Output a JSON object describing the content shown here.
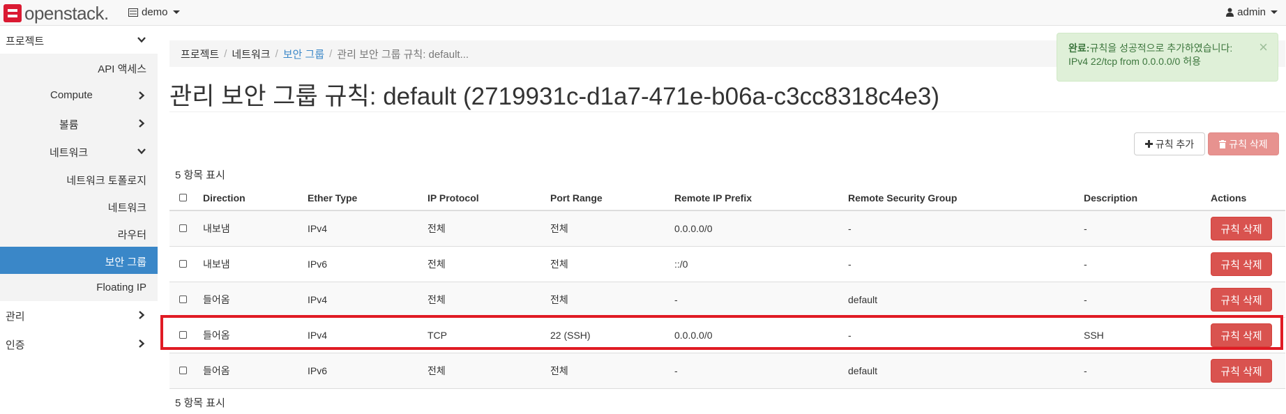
{
  "navbar": {
    "logo_text": "openstack.",
    "project_label": "demo",
    "user_label": "admin"
  },
  "sidebar": {
    "items": [
      {
        "label": "프로젝트",
        "chevron": "down"
      },
      {
        "label": "API 액세스"
      },
      {
        "label": "Compute",
        "chevron": "right"
      },
      {
        "label": "볼륨",
        "chevron": "right"
      },
      {
        "label": "네트워크",
        "chevron": "down"
      },
      {
        "label": "네트워크 토폴로지"
      },
      {
        "label": "네트워크"
      },
      {
        "label": "라우터"
      },
      {
        "label": "보안 그룹"
      },
      {
        "label": "Floating IP"
      },
      {
        "label": "관리",
        "chevron": "right"
      },
      {
        "label": "인증",
        "chevron": "right"
      }
    ]
  },
  "breadcrumb": {
    "items": [
      "프로젝트",
      "네트워크",
      "보안 그룹",
      "관리 보안 그룹 규칙: default..."
    ]
  },
  "page": {
    "title": "관리 보안 그룹 규칙: default (2719931c-d1a7-471e-b06a-c3cc8318c4e3)"
  },
  "alert": {
    "strong": "완료:",
    "message": "규칙을 성공적으로 추가하였습니다: IPv4 22/tcp from 0.0.0.0/0 허용",
    "close": "×"
  },
  "toolbar": {
    "add_label": "규칙 추가",
    "delete_label": "규칙 삭제"
  },
  "table": {
    "count_label": "5 항목 표시",
    "columns": [
      "Direction",
      "Ether Type",
      "IP Protocol",
      "Port Range",
      "Remote IP Prefix",
      "Remote Security Group",
      "Description",
      "Actions"
    ],
    "rows": [
      {
        "direction": "내보냄",
        "ether": "IPv4",
        "protocol": "전체",
        "port": "전체",
        "prefix": "0.0.0.0/0",
        "group": "-",
        "description": "-",
        "action": "규칙 삭제"
      },
      {
        "direction": "내보냄",
        "ether": "IPv6",
        "protocol": "전체",
        "port": "전체",
        "prefix": "::/0",
        "group": "-",
        "description": "-",
        "action": "규칙 삭제"
      },
      {
        "direction": "들어옴",
        "ether": "IPv4",
        "protocol": "전체",
        "port": "전체",
        "prefix": "-",
        "group": "default",
        "description": "-",
        "action": "규칙 삭제"
      },
      {
        "direction": "들어옴",
        "ether": "IPv4",
        "protocol": "TCP",
        "port": "22 (SSH)",
        "prefix": "0.0.0.0/0",
        "group": "-",
        "description": "SSH",
        "action": "규칙 삭제"
      },
      {
        "direction": "들어옴",
        "ether": "IPv6",
        "protocol": "전체",
        "port": "전체",
        "prefix": "-",
        "group": "default",
        "description": "-",
        "action": "규칙 삭제"
      }
    ]
  },
  "colors": {
    "accent": "#3a87c8",
    "danger": "#d9534f",
    "highlight": "#e01b24",
    "success_bg": "#dff0d8"
  }
}
